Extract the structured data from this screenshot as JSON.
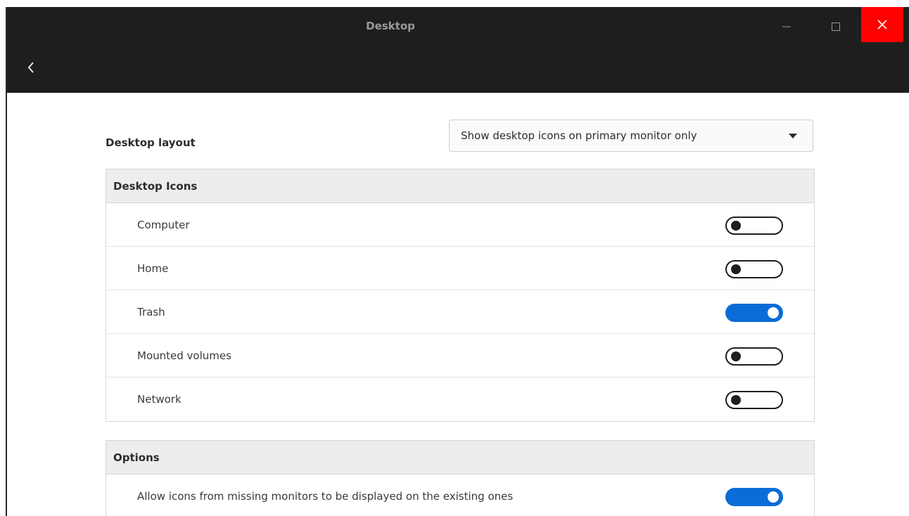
{
  "window": {
    "title": "Desktop",
    "controls": {
      "minimize": "minimize-icon",
      "maximize": "maximize-icon",
      "close": "close-icon"
    },
    "back": "chevron-left-icon"
  },
  "desktop_layout": {
    "label": "Desktop layout",
    "selected": "Show desktop icons on primary monitor only"
  },
  "desktop_icons": {
    "header": "Desktop Icons",
    "items": [
      {
        "label": "Computer",
        "enabled": false
      },
      {
        "label": "Home",
        "enabled": false
      },
      {
        "label": "Trash",
        "enabled": true
      },
      {
        "label": "Mounted volumes",
        "enabled": false
      },
      {
        "label": "Network",
        "enabled": false
      }
    ]
  },
  "options": {
    "header": "Options",
    "items": [
      {
        "label": "Allow icons from missing monitors to be displayed on the existing ones",
        "enabled": true
      }
    ]
  },
  "colors": {
    "titlebar": "#1e1e1e",
    "close_button": "#ff0000",
    "switch_on": "#0a6cd6",
    "section_header": "#ededed"
  }
}
